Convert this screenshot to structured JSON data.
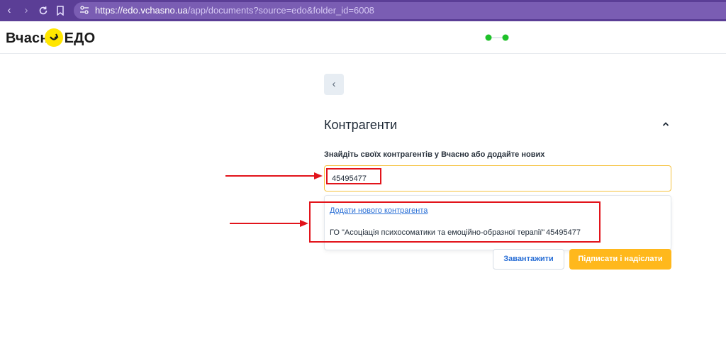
{
  "browser": {
    "url_host": "https://edo.vchasno.ua",
    "url_path": "/app/documents?source=edo&folder_id=6008"
  },
  "header": {
    "logo_left": "Вчасн",
    "logo_right": "ЕДО"
  },
  "section": {
    "title": "Контрагенти",
    "hint": "Знайдіть своїх контрагентів у Вчасно або додайте нових"
  },
  "search": {
    "value": "45495477"
  },
  "dropdown": {
    "add_link": "Додати нового контрагента",
    "results": [
      {
        "name": "ГО \"Асоціація психосоматики та емоційно-образної терапії\"",
        "code": "45495477"
      }
    ]
  },
  "actions": {
    "upload_label": "Завантажити",
    "sign_label": "Підписати і надіслати"
  },
  "colors": {
    "browser_bar": "#5b3e96",
    "accent_yellow": "#ffb81c",
    "focus_border": "#f5c23e",
    "link_blue": "#2a6fd6",
    "annotation_red": "#e2141b",
    "status_green": "#1fc12a"
  },
  "icons": {
    "back": "chevron-left-icon",
    "collapse": "chevron-up-icon",
    "status": "status-dots-icon"
  }
}
